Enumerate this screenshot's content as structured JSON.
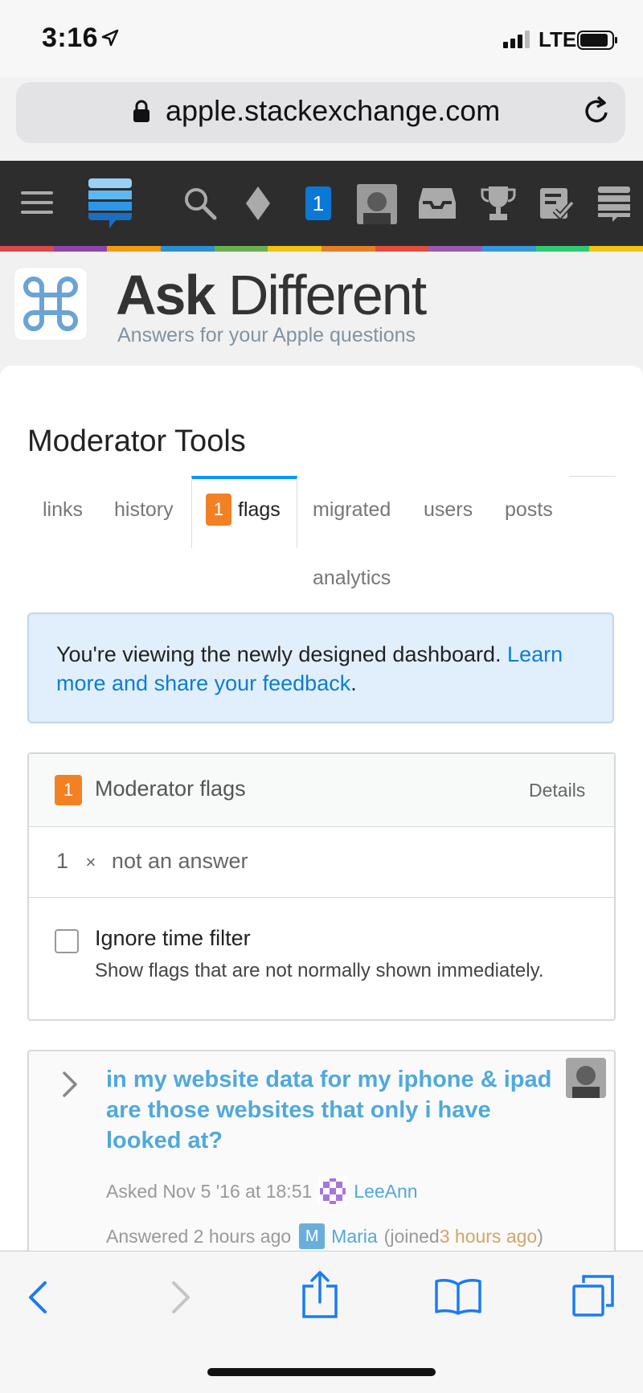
{
  "status_bar": {
    "time": "3:16",
    "network": "LTE"
  },
  "browser": {
    "url": "apple.stackexchange.com"
  },
  "topbar": {
    "inbox_count": "1"
  },
  "colors": {
    "accent": "#0a95ff",
    "flag_orange": "#f48024",
    "link_blue": "#4fa9dc",
    "topbar_bg": "#2d2d2e"
  },
  "site": {
    "name_bold": "Ask",
    "name_rest": " Different",
    "tagline": "Answers for your Apple questions"
  },
  "page": {
    "title": "Moderator Tools",
    "tabs": [
      {
        "label": "links"
      },
      {
        "label": "history"
      },
      {
        "label": "flags",
        "badge": "1"
      },
      {
        "label": "migrated"
      },
      {
        "label": "users"
      },
      {
        "label": "posts"
      },
      {
        "label": "analytics"
      }
    ]
  },
  "notice": {
    "text": "You're viewing the newly designed dashboard. ",
    "link": "Learn more and share your feedback",
    "end": "."
  },
  "flags_card": {
    "badge": "1",
    "title": "Moderator flags",
    "details": "Details",
    "row_count": "1",
    "row_times": "×",
    "row_label": "not an answer",
    "ignore_label": "Ignore time filter",
    "ignore_desc": "Show flags that are not normally shown immediately."
  },
  "post": {
    "title": "in my website data for my iphone & ipad are those websites that only i have looked at?",
    "asked_prefix": "Asked Nov 5 '16 at 18:51",
    "asker": "LeeAnn",
    "answered_prefix": "Answered 2 hours ago",
    "answerer_initial": "M",
    "answerer": "Maria",
    "joined_prefix": "(joined ",
    "joined_time": "3 hours ago",
    "joined_suffix": ")"
  }
}
